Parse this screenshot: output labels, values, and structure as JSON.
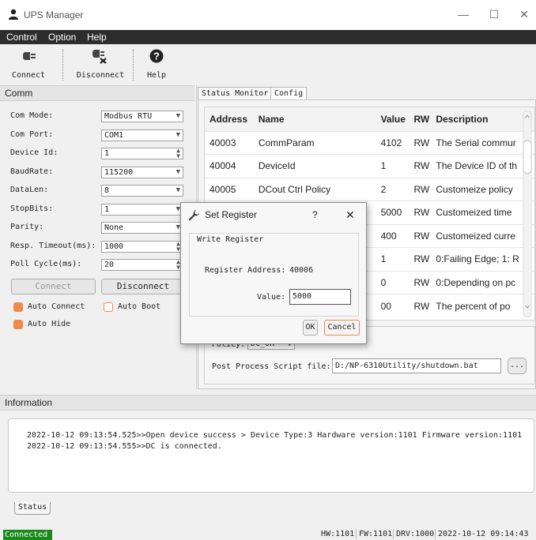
{
  "window": {
    "title": "UPS Manager",
    "minimize": "—",
    "maximize": "☐",
    "close": "✕"
  },
  "menu": [
    "Control",
    "Option",
    "Help"
  ],
  "toolbar": {
    "connect": "Connect",
    "disconnect": "Disconnect",
    "help": "Help"
  },
  "comm": {
    "header": "Comm",
    "fields": [
      {
        "label": "Com Mode:",
        "value": "Modbus RTU",
        "kind": "select"
      },
      {
        "label": "Com Port:",
        "value": "COM1",
        "kind": "select"
      },
      {
        "label": "Device Id:",
        "value": "1",
        "kind": "spin"
      },
      {
        "label": "BaudRate:",
        "value": "115200",
        "kind": "select"
      },
      {
        "label": "DataLen:",
        "value": "8",
        "kind": "select"
      },
      {
        "label": "StopBits:",
        "value": "1",
        "kind": "select"
      },
      {
        "label": "Parity:",
        "value": "None",
        "kind": "select"
      },
      {
        "label": "Resp. Timeout(ms):",
        "value": "1000",
        "kind": "spin"
      },
      {
        "label": "Poll Cycle(ms):",
        "value": "20",
        "kind": "spin"
      }
    ],
    "connect_btn": "Connect",
    "disconnect_btn": "Disconnect",
    "auto_connect": "Auto Connect",
    "auto_boot": "Auto Boot",
    "auto_hide": "Auto Hide"
  },
  "tabs": [
    "Status Monitor",
    "Config"
  ],
  "table": {
    "headers": [
      "Address",
      "Name",
      "Value",
      "RW",
      "Description"
    ],
    "rows": [
      [
        "40003",
        "CommParam",
        "4102",
        "RW",
        "The Serial commur"
      ],
      [
        "40004",
        "DeviceId",
        "1",
        "RW",
        "The Device ID of th"
      ],
      [
        "40005",
        "DCout Ctrl Policy",
        "2",
        "RW",
        "Customeize policy"
      ],
      [
        "",
        "",
        "5000",
        "RW",
        "Customeized time"
      ],
      [
        "",
        "",
        "400",
        "RW",
        "Customeized curre"
      ],
      [
        "",
        "",
        "1",
        "RW",
        "0:Failing Edge; 1: R"
      ],
      [
        "",
        "",
        "0",
        "RW",
        "0:Depending on pc"
      ],
      [
        "",
        "",
        "00",
        "RW",
        "The percent of po"
      ]
    ]
  },
  "config": {
    "policy_label": "Policy:",
    "policy_value": "DC_OK",
    "script_label": "Post Process Script file:",
    "script_value": "D:/NP-6310Utility/shutdown.bat",
    "browse": "..."
  },
  "dialog": {
    "title": "Set Register",
    "help": "?",
    "close": "✕",
    "group": "Write Register",
    "addr_label": "Register Address:",
    "addr_value": "40006",
    "value_label": "Value:",
    "value": "5000",
    "ok": "OK",
    "cancel": "Cancel"
  },
  "info": {
    "header": "Information",
    "lines": [
      "2022-10-12 09:13:54.525>>Open device success > Device Type:3 Hardware version:1101 Firmware version:1101",
      "2022-10-12 09:13:54.555>>DC is connected."
    ],
    "tab": "Status"
  },
  "status": {
    "connected": "Connected",
    "hw": "HW:1101",
    "fw": "FW:1101",
    "drv": "DRV:1000",
    "time": "2022-10-12 09:14:43"
  },
  "colors": {
    "connected_bg": "#1a8a1a",
    "accent_orange": "#f08a4b",
    "menubar": "#2d2d2d"
  }
}
